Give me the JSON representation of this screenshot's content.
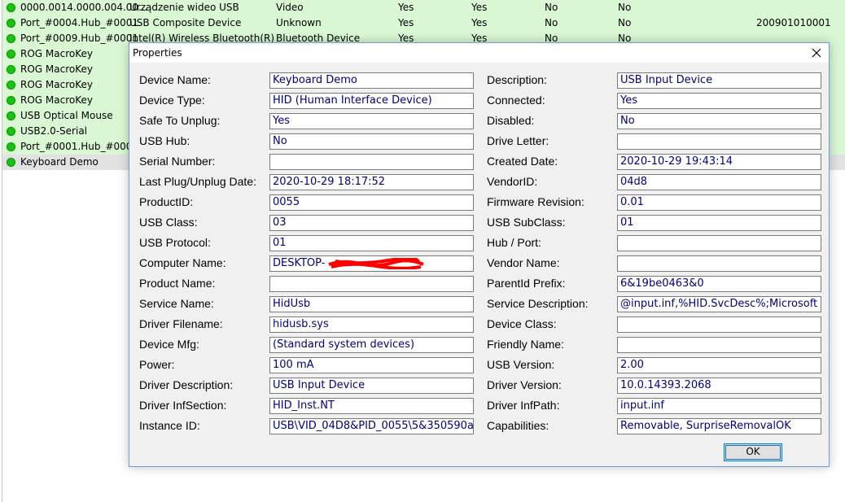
{
  "list": {
    "rows": [
      {
        "name": "0000.0014.0000.004.00...",
        "description": "Urządzenie wideo USB",
        "type": "Video",
        "connected": "Yes",
        "safe": "Yes",
        "disabled": "No",
        "hub": "No",
        "serial": ""
      },
      {
        "name": "Port_#0004.Hub_#0001",
        "description": "USB Composite Device",
        "type": "Unknown",
        "connected": "Yes",
        "safe": "Yes",
        "disabled": "No",
        "hub": "No",
        "serial": "200901010001"
      },
      {
        "name": "Port_#0009.Hub_#0001",
        "description": "Intel(R) Wireless Bluetooth(R)",
        "type": "Bluetooth Device",
        "connected": "Yes",
        "safe": "Yes",
        "disabled": "No",
        "hub": "No",
        "serial": ""
      },
      {
        "name": "ROG MacroKey"
      },
      {
        "name": "ROG MacroKey"
      },
      {
        "name": "ROG MacroKey"
      },
      {
        "name": "ROG MacroKey"
      },
      {
        "name": "USB Optical Mouse"
      },
      {
        "name": "USB2.0-Serial"
      },
      {
        "name": "Port_#0001.Hub_#0001"
      },
      {
        "name": "Keyboard Demo"
      }
    ]
  },
  "dialog": {
    "title": "Properties",
    "ok_label": "OK",
    "left_fields": [
      {
        "label": "Device Name:",
        "value": "Keyboard Demo"
      },
      {
        "label": "Device Type:",
        "value": "HID (Human Interface Device)"
      },
      {
        "label": "Safe To Unplug:",
        "value": "Yes"
      },
      {
        "label": "USB Hub:",
        "value": "No"
      },
      {
        "label": "Serial Number:",
        "value": ""
      },
      {
        "label": "Last Plug/Unplug Date:",
        "value": "2020-10-29 18:17:52"
      },
      {
        "label": "ProductID:",
        "value": "0055"
      },
      {
        "label": "USB Class:",
        "value": "03"
      },
      {
        "label": "USB Protocol:",
        "value": "01"
      },
      {
        "label": "Computer Name:",
        "value": "DESKTOP-"
      },
      {
        "label": "Product Name:",
        "value": ""
      },
      {
        "label": "Service Name:",
        "value": "HidUsb"
      },
      {
        "label": "Driver Filename:",
        "value": "hidusb.sys"
      },
      {
        "label": "Device Mfg:",
        "value": "(Standard system devices)"
      },
      {
        "label": "Power:",
        "value": "100 mA"
      },
      {
        "label": "Driver Description:",
        "value": "USB Input Device"
      },
      {
        "label": "Driver InfSection:",
        "value": "HID_Inst.NT"
      },
      {
        "label": "Instance ID:",
        "value": "USB\\VID_04D8&PID_0055\\5&350590a"
      }
    ],
    "right_fields": [
      {
        "label": "Description:",
        "value": "USB Input Device"
      },
      {
        "label": "Connected:",
        "value": "Yes"
      },
      {
        "label": "Disabled:",
        "value": "No"
      },
      {
        "label": "Drive Letter:",
        "value": ""
      },
      {
        "label": "Created Date:",
        "value": "2020-10-29 19:43:14"
      },
      {
        "label": "VendorID:",
        "value": "04d8"
      },
      {
        "label": "Firmware Revision:",
        "value": "0.01"
      },
      {
        "label": "USB SubClass:",
        "value": "01"
      },
      {
        "label": "Hub / Port:",
        "value": ""
      },
      {
        "label": "Vendor Name:",
        "value": ""
      },
      {
        "label": "ParentId Prefix:",
        "value": "6&19be0463&0"
      },
      {
        "label": "Service Description:",
        "value": "@input.inf,%HID.SvcDesc%;Microsoft"
      },
      {
        "label": "Device Class:",
        "value": ""
      },
      {
        "label": "Friendly Name:",
        "value": ""
      },
      {
        "label": "USB Version:",
        "value": "2.00"
      },
      {
        "label": "Driver Version:",
        "value": "10.0.14393.2068"
      },
      {
        "label": "Driver InfPath:",
        "value": "input.inf"
      },
      {
        "label": "Capabilities:",
        "value": "Removable, SurpriseRemovalOK"
      }
    ]
  },
  "icons": {
    "status": "green-dot-icon",
    "close": "close-x-icon"
  },
  "colors": {
    "row_bg": "#d9f7d3",
    "selected_row_bg": "#e2e2e2",
    "status_dot": "#16c60c",
    "field_text": "#000080",
    "dialog_bg": "#f0f0f0",
    "redaction": "#ff0000"
  }
}
